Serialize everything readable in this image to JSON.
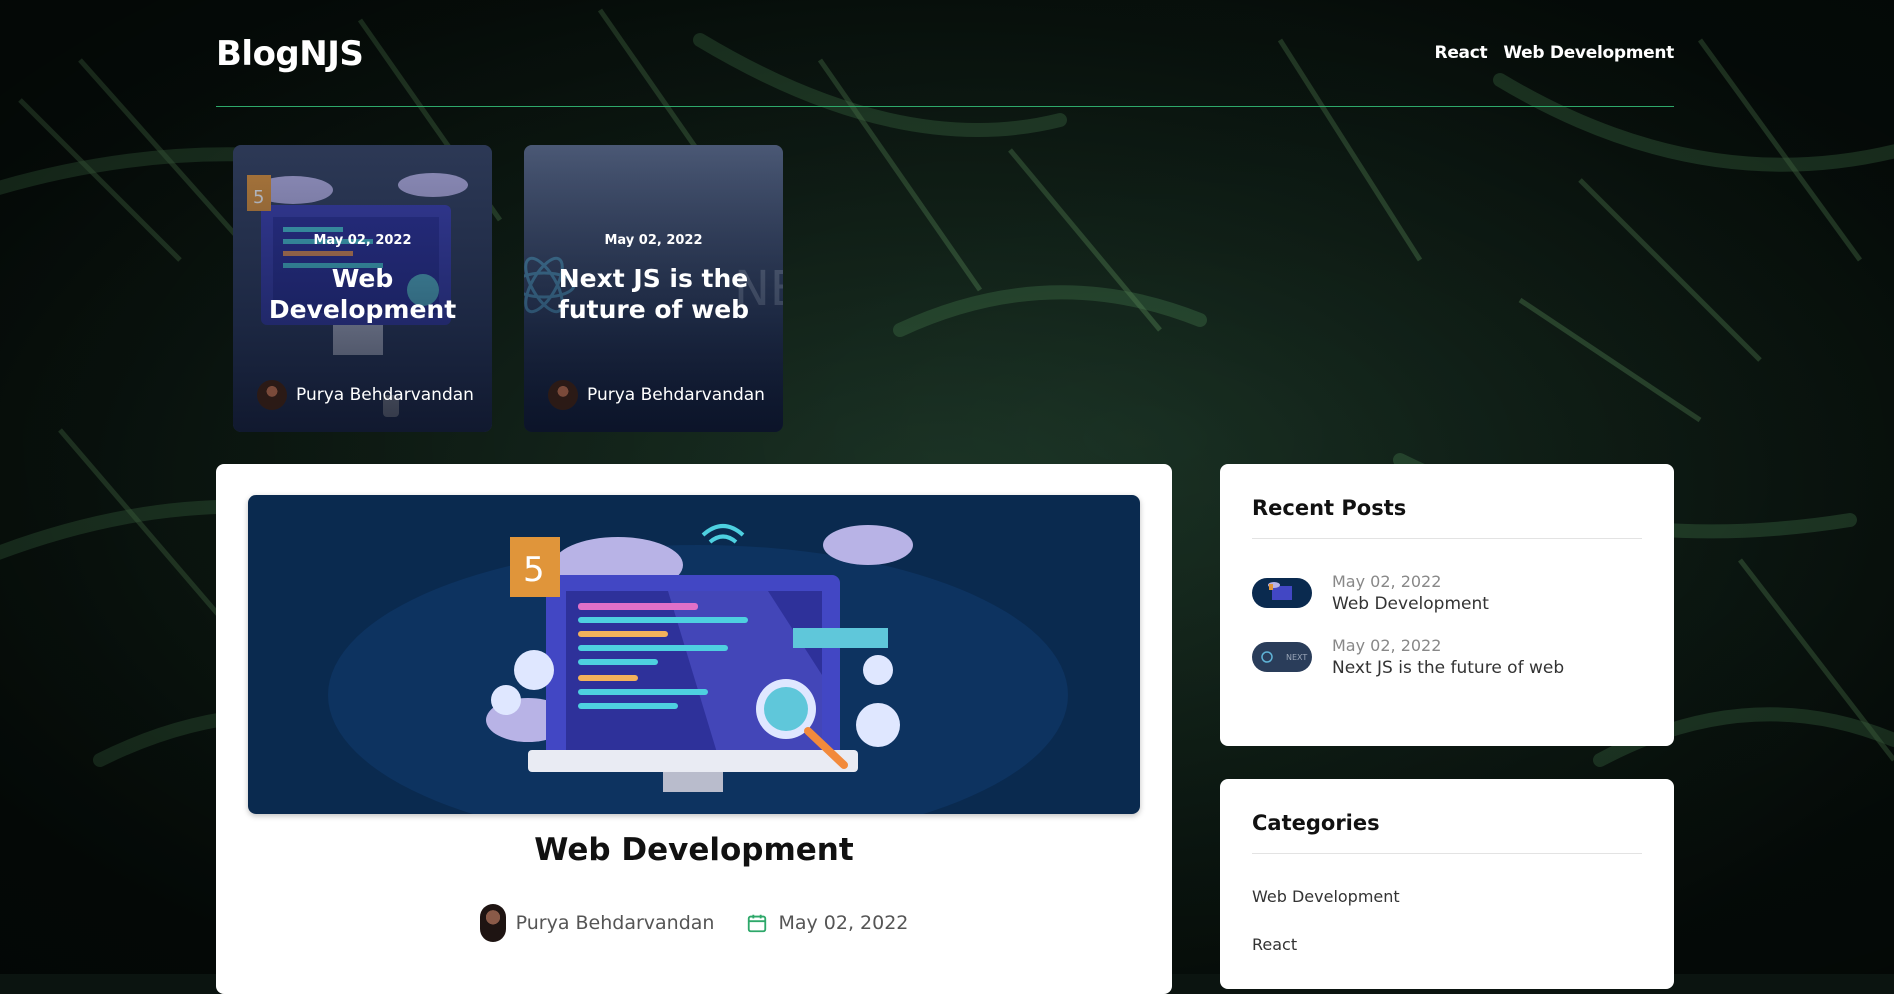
{
  "site": {
    "logo": "BlogNJS"
  },
  "nav": {
    "items": [
      "React",
      "Web Development"
    ]
  },
  "featured": [
    {
      "date": "May 02, 2022",
      "title": "Web Development",
      "author": "Purya Behdarvandan"
    },
    {
      "date": "May 02, 2022",
      "title": "Next JS is the future of web",
      "author": "Purya Behdarvandan"
    }
  ],
  "post": {
    "title": "Web Development",
    "author": "Purya Behdarvandan",
    "date": "May 02, 2022"
  },
  "sidebar": {
    "recent": {
      "heading": "Recent Posts",
      "items": [
        {
          "date": "May 02, 2022",
          "title": "Web Development"
        },
        {
          "date": "May 02, 2022",
          "title": "Next JS is the future of web"
        }
      ]
    },
    "categories": {
      "heading": "Categories",
      "items": [
        "Web Development",
        "React"
      ]
    }
  },
  "colors": {
    "accent": "#2ea86a",
    "hero_bg": "#0a2a4f",
    "card_bg": "#ffffff"
  },
  "icons": {
    "calendar": "calendar-icon"
  }
}
